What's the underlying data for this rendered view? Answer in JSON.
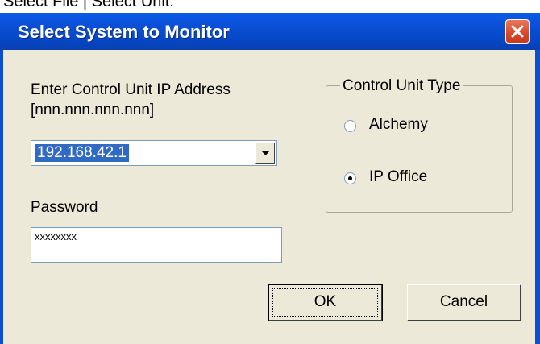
{
  "top_caption": "Select File | Select Unit.",
  "dialog": {
    "title": "Select System to Monitor",
    "close_label": "×"
  },
  "ip_section": {
    "label_line1": "Enter Control Unit IP Address",
    "label_line2": "[nnn.nnn.nnn.nnn]",
    "selected_value": "192.168.42.1"
  },
  "password": {
    "label": "Password",
    "masked_value": "xxxxxxxx"
  },
  "unit_type": {
    "legend": "Control Unit Type",
    "options": [
      {
        "label": "Alchemy",
        "checked": false
      },
      {
        "label": "IP Office",
        "checked": true
      }
    ]
  },
  "buttons": {
    "ok_label": "OK",
    "cancel_label": "Cancel"
  }
}
